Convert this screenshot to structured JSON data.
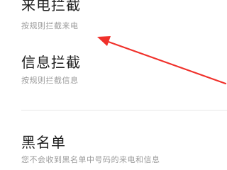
{
  "settings": {
    "call_block": {
      "title": "来电拦截",
      "subtitle": "按规则拦截来电"
    },
    "message_block": {
      "title": "信息拦截",
      "subtitle": "按规则拦截信息"
    },
    "blacklist": {
      "title": "黑名单",
      "subtitle": "您不会收到黑名单中号码的来电和信息"
    }
  },
  "annotation": {
    "arrow_color": "#f0302a"
  }
}
